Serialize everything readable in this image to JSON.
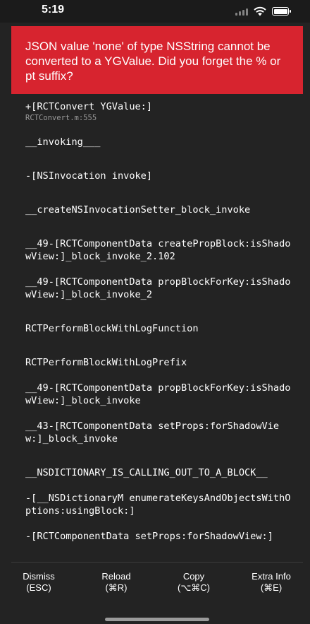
{
  "status_bar": {
    "time": "5:19"
  },
  "error": {
    "message": "JSON value 'none' of type NSString cannot be converted to a YGValue. Did you forget the % or pt suffix?"
  },
  "stack_frames": [
    {
      "method": "+[RCTConvert YGValue:]",
      "file": "RCTConvert.m:555"
    },
    {
      "method": "__invoking___",
      "file": ""
    },
    {
      "method": "-[NSInvocation invoke]",
      "file": ""
    },
    {
      "method": "__createNSInvocationSetter_block_invoke",
      "file": ""
    },
    {
      "method": "__49-[RCTComponentData createPropBlock:isShadowView:]_block_invoke_2.102",
      "file": ""
    },
    {
      "method": "__49-[RCTComponentData propBlockForKey:isShadowView:]_block_invoke_2",
      "file": ""
    },
    {
      "method": "RCTPerformBlockWithLogFunction",
      "file": ""
    },
    {
      "method": "RCTPerformBlockWithLogPrefix",
      "file": ""
    },
    {
      "method": "__49-[RCTComponentData propBlockForKey:isShadowView:]_block_invoke",
      "file": ""
    },
    {
      "method": "__43-[RCTComponentData setProps:forShadowView:]_block_invoke",
      "file": ""
    },
    {
      "method": "__NSDICTIONARY_IS_CALLING_OUT_TO_A_BLOCK__",
      "file": ""
    },
    {
      "method": "-[__NSDictionaryM enumerateKeysAndObjectsWithOptions:usingBlock:]",
      "file": ""
    },
    {
      "method": "-[RCTComponentData setProps:forShadowView:]",
      "file": ""
    }
  ],
  "toolbar": {
    "dismiss_label": "Dismiss",
    "dismiss_shortcut": "(ESC)",
    "reload_label": "Reload",
    "reload_shortcut": "(⌘R)",
    "copy_label": "Copy",
    "copy_shortcut": "(⌥⌘C)",
    "extra_label": "Extra Info",
    "extra_shortcut": "(⌘E)"
  },
  "colors": {
    "background": "#232323",
    "error_banner": "#d7242f",
    "text": "#ffffff",
    "file_text": "#9a9a9a"
  }
}
